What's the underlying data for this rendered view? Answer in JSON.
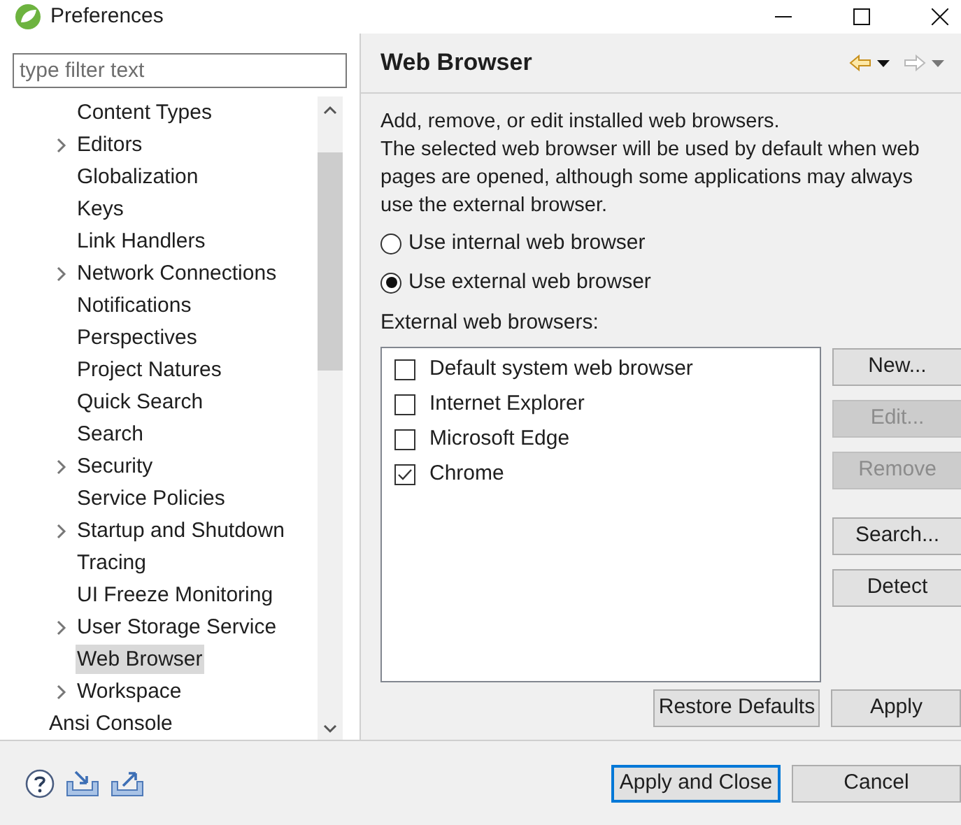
{
  "window": {
    "title": "Preferences"
  },
  "filter": {
    "placeholder": "type filter text"
  },
  "tree": {
    "items": [
      {
        "children": [
          {
            "label": "Content Types",
            "expandable": false,
            "selected": false
          },
          {
            "label": "Editors",
            "expandable": true,
            "selected": false
          },
          {
            "label": "Globalization",
            "expandable": false,
            "selected": false
          },
          {
            "label": "Keys",
            "expandable": false,
            "selected": false
          },
          {
            "label": "Link Handlers",
            "expandable": false,
            "selected": false
          },
          {
            "label": "Network Connections",
            "expandable": true,
            "selected": false
          },
          {
            "label": "Notifications",
            "expandable": false,
            "selected": false
          },
          {
            "label": "Perspectives",
            "expandable": false,
            "selected": false
          },
          {
            "label": "Project Natures",
            "expandable": false,
            "selected": false
          },
          {
            "label": "Quick Search",
            "expandable": false,
            "selected": false
          },
          {
            "label": "Search",
            "expandable": false,
            "selected": false
          },
          {
            "label": "Security",
            "expandable": true,
            "selected": false
          },
          {
            "label": "Service Policies",
            "expandable": false,
            "selected": false
          },
          {
            "label": "Startup and Shutdown",
            "expandable": true,
            "selected": false
          },
          {
            "label": "Tracing",
            "expandable": false,
            "selected": false
          },
          {
            "label": "UI Freeze Monitoring",
            "expandable": false,
            "selected": false
          },
          {
            "label": "User Storage Service",
            "expandable": true,
            "selected": false
          },
          {
            "label": "Web Browser",
            "expandable": false,
            "selected": true
          },
          {
            "label": "Workspace",
            "expandable": true,
            "selected": false
          }
        ]
      },
      {
        "label": "Ansi Console",
        "expandable": false,
        "selected": false
      }
    ]
  },
  "page": {
    "title": "Web Browser",
    "description": "Add, remove, or edit installed web browsers.\nThe selected web browser will be used by default when web pages are opened, although some applications may always use the external browser.",
    "radios": [
      {
        "label": "Use internal web browser",
        "selected": false
      },
      {
        "label": "Use external web browser",
        "selected": true
      }
    ],
    "list_label": "External web browsers:",
    "browsers": [
      {
        "label": "Default system web browser",
        "checked": false
      },
      {
        "label": "Internet Explorer",
        "checked": false
      },
      {
        "label": "Microsoft Edge",
        "checked": false
      },
      {
        "label": "Chrome",
        "checked": true
      }
    ],
    "side_buttons": [
      {
        "label": "New...",
        "disabled": false
      },
      {
        "label": "Edit...",
        "disabled": true
      },
      {
        "label": "Remove",
        "disabled": true
      },
      {
        "label": "Search...",
        "disabled": false
      },
      {
        "label": "Detect",
        "disabled": false
      }
    ],
    "restore_button": "Restore Defaults",
    "apply_button": "Apply"
  },
  "footer": {
    "buttons": [
      {
        "label": "Apply and Close",
        "default": true
      },
      {
        "label": "Cancel",
        "default": false
      }
    ]
  }
}
